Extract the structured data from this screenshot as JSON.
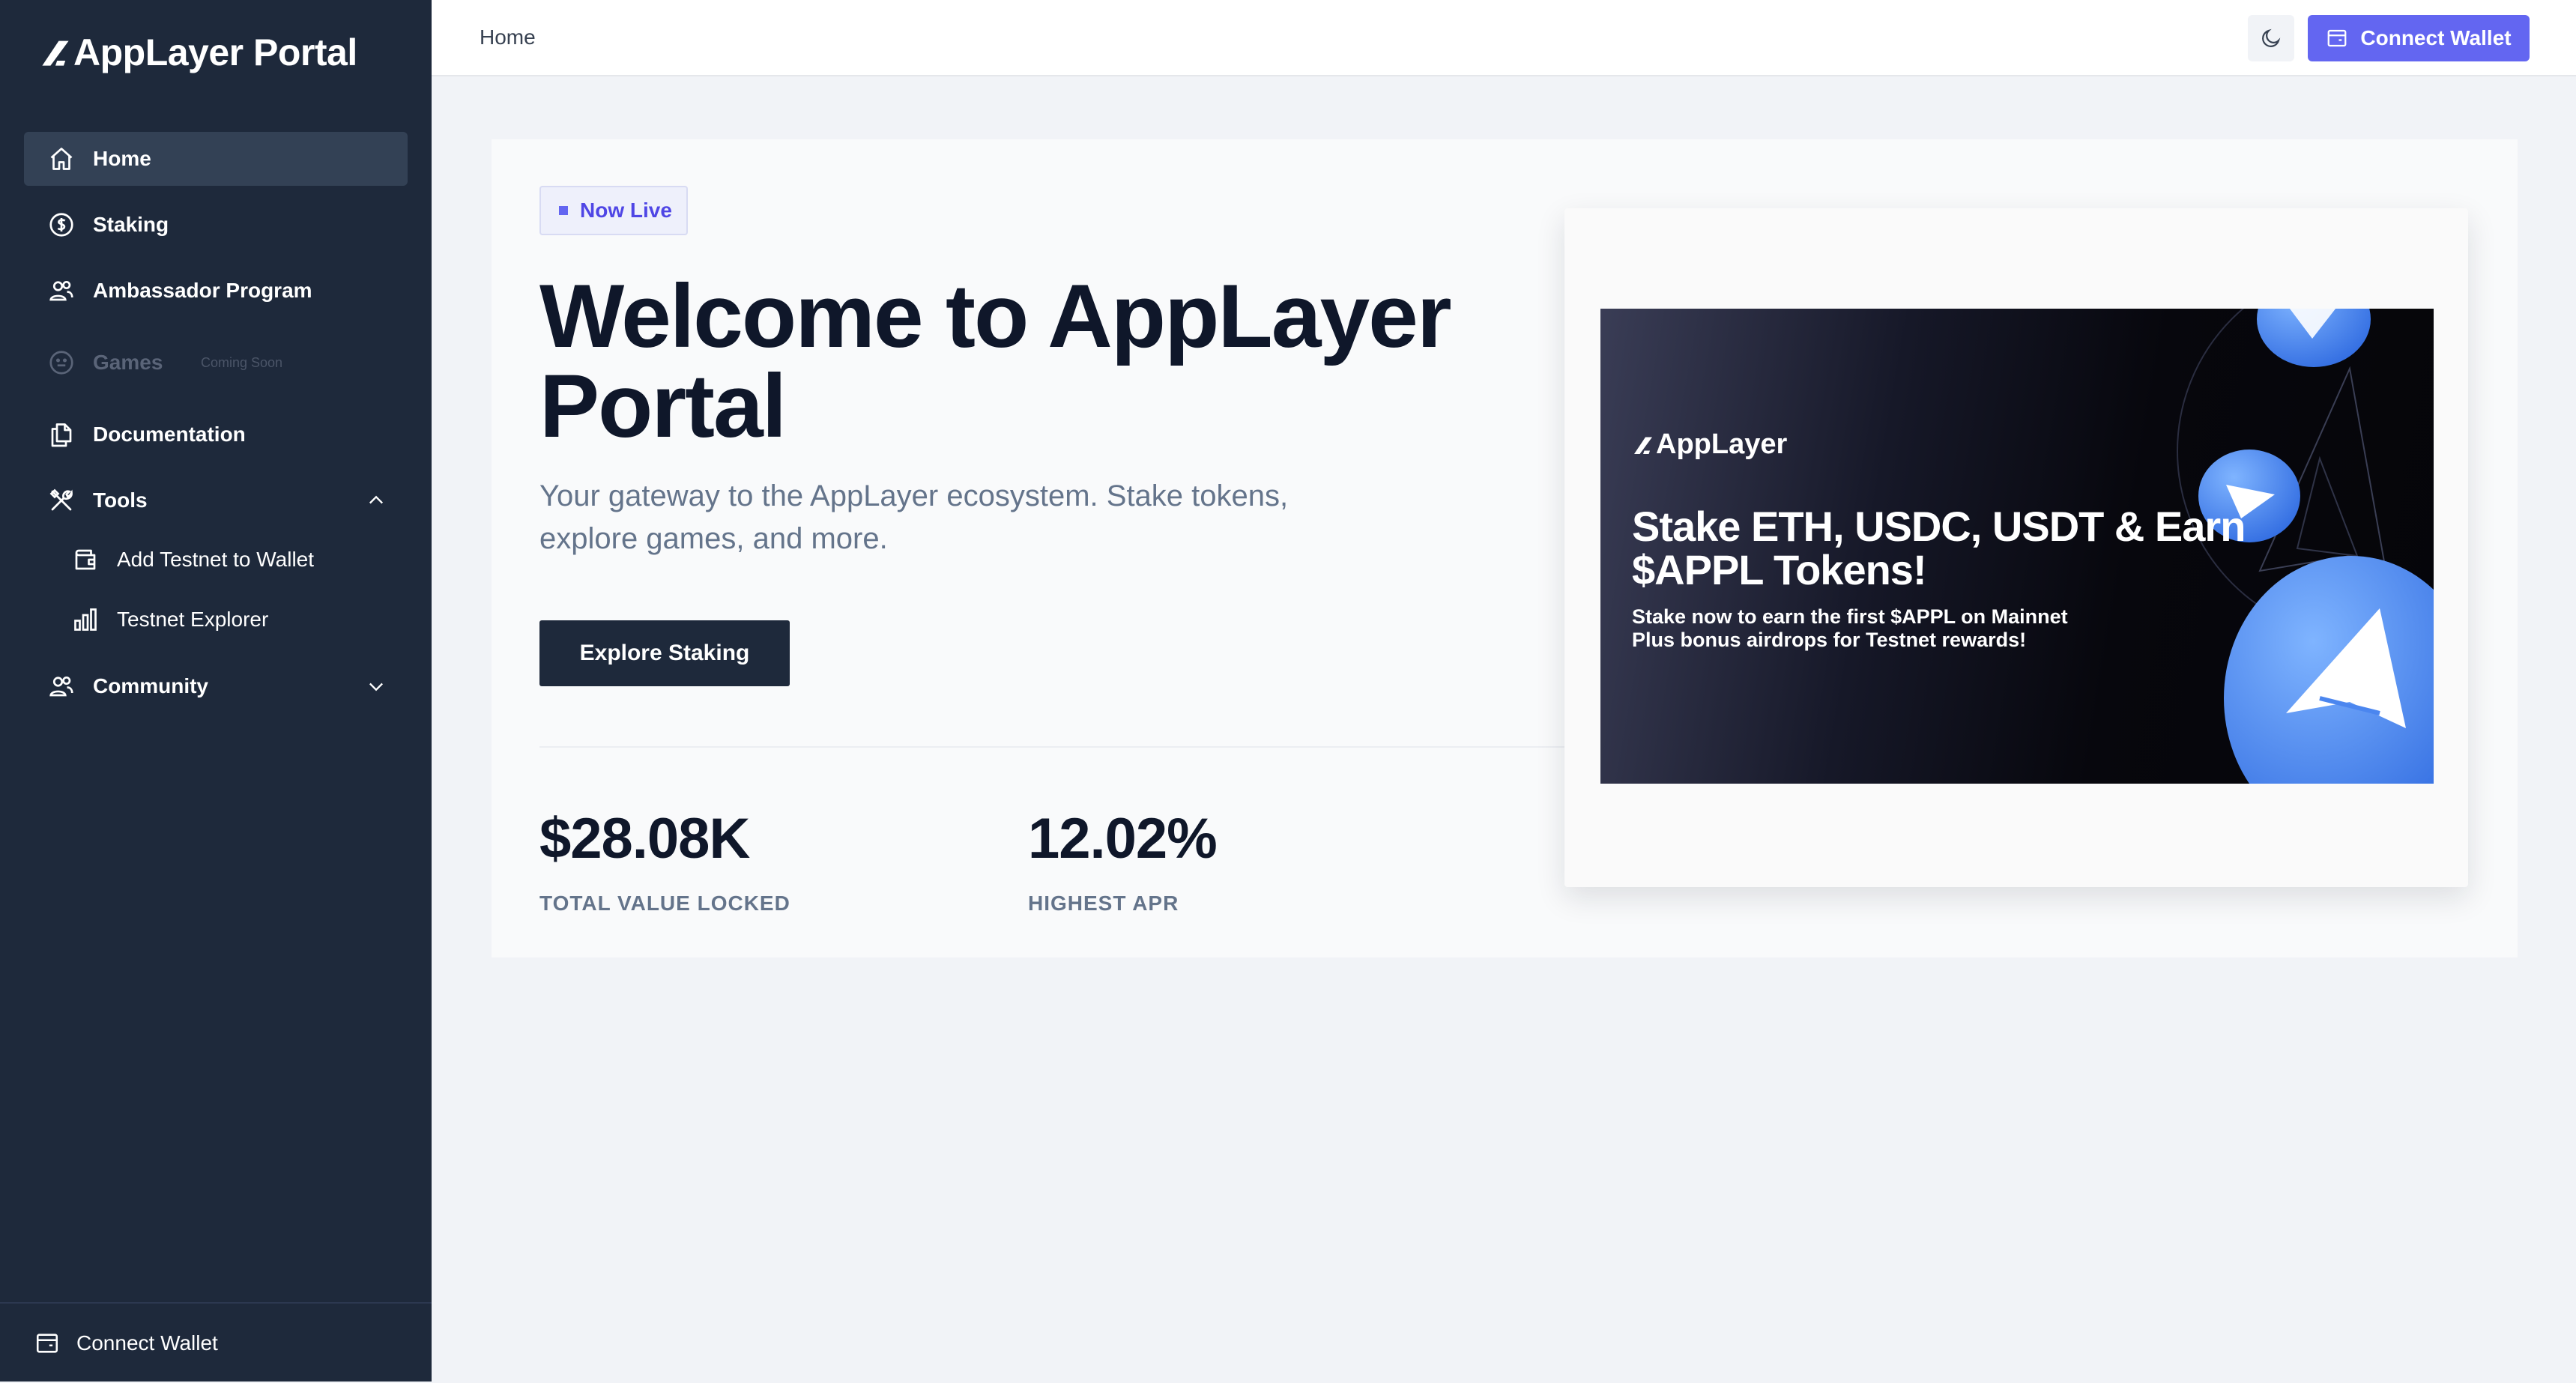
{
  "sidebar": {
    "brand": "AppLayer Portal",
    "nav": {
      "home": "Home",
      "staking": "Staking",
      "ambassador": "Ambassador Program",
      "games": "Games",
      "games_badge": "Coming Soon",
      "documentation": "Documentation",
      "tools": "Tools",
      "add_testnet": "Add Testnet to Wallet",
      "testnet_explorer": "Testnet Explorer",
      "community": "Community"
    },
    "footer_connect": "Connect Wallet"
  },
  "topbar": {
    "breadcrumb": "Home",
    "connect_label": "Connect Wallet"
  },
  "hero": {
    "badge": "Now Live",
    "title": "Welcome to AppLayer Portal",
    "subtitle": "Your gateway to the AppLayer ecosystem. Stake tokens, explore games, and more.",
    "cta": "Explore Staking",
    "stats": [
      {
        "value": "$28.08K",
        "label": "TOTAL VALUE LOCKED"
      },
      {
        "value": "12.02%",
        "label": "HIGHEST APR"
      }
    ]
  },
  "promo": {
    "brand": "AppLayer",
    "headline": "Stake ETH, USDC, USDT & Earn $APPL Tokens!",
    "line1": "Stake now to earn the first $APPL on Mainnet",
    "line2": "Plus bonus airdrops for Testnet rewards!"
  },
  "icons": {
    "home": "home-icon",
    "staking": "dollar-circle-icon",
    "ambassador": "users-icon",
    "games": "smiley-icon",
    "documentation": "documents-icon",
    "tools": "tools-icon",
    "add_testnet": "wallet-icon",
    "testnet_explorer": "bar-chart-icon",
    "community": "users-icon",
    "theme": "moon-icon",
    "connect": "wallet-card-icon"
  },
  "colors": {
    "sidebar_bg": "#1e293b",
    "active_item_bg": "#334155",
    "accent": "#6366f1",
    "page_bg": "#f1f3f7",
    "headline": "#0f172a",
    "muted_text": "#64748b"
  }
}
